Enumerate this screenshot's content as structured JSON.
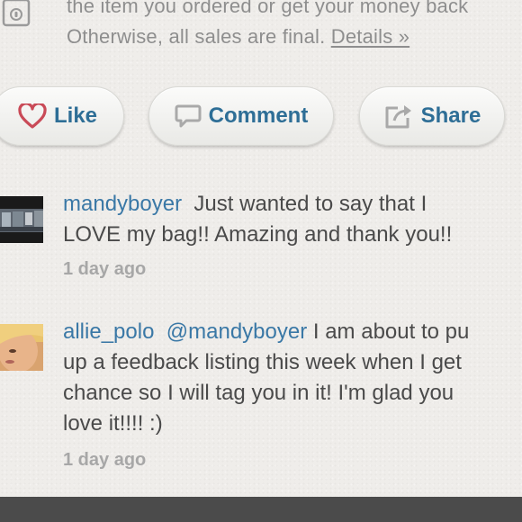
{
  "policy": {
    "line1": "the item you ordered or get your money back",
    "line2": "Otherwise, all sales are final.",
    "details_link": "Details »",
    "icon": "lock-icon"
  },
  "actions": {
    "like": {
      "label": "Like",
      "icon": "heart-icon"
    },
    "comment": {
      "label": "Comment",
      "icon": "speech-bubble-icon"
    },
    "share": {
      "label": "Share",
      "icon": "share-arrow-icon"
    }
  },
  "comments": [
    {
      "username": "mandyboyer",
      "line1": "Just wanted to say that I",
      "line2": "LOVE my bag!! Amazing and thank you!!",
      "time": "1 day ago"
    },
    {
      "username": "allie_polo",
      "mention": "@mandyboyer",
      "line1": "I am about to pu",
      "line2": "up a feedback listing this week when I get",
      "line3": "chance so I will tag you in it! I'm glad you",
      "line4": "love it!!!! :)",
      "time": "1 day ago"
    }
  ],
  "colors": {
    "link_blue": "#3a78a6",
    "button_text": "#2e6e96",
    "like_heart": "#c94a57",
    "background": "#efedea"
  }
}
